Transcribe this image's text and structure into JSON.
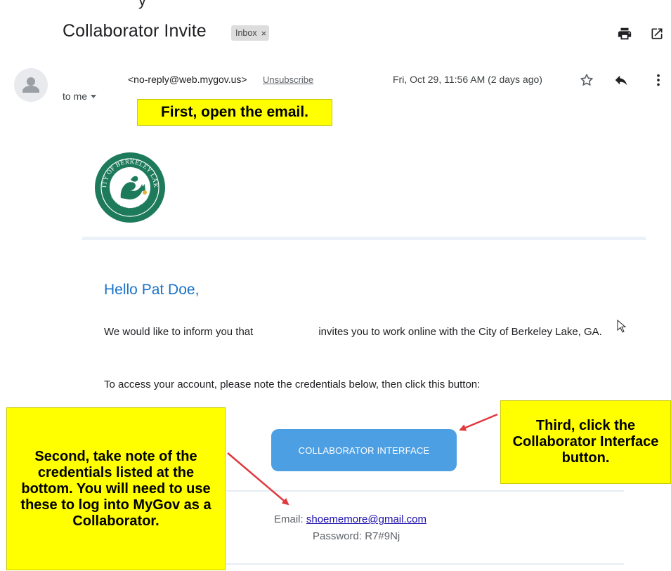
{
  "header": {
    "partial_text": "y",
    "subject": "Collaborator Invite",
    "label_badge": "Inbox",
    "label_close": "×",
    "print_icon": "print-icon",
    "new_window_icon": "open-in-new-icon"
  },
  "message": {
    "sender": "<no-reply@web.mygov.us>",
    "unsubscribe": "Unsubscribe",
    "date": "Fri, Oct 29, 11:56 AM (2 days ago)",
    "to": "to me",
    "icons": [
      "avatar-icon",
      "star-icon",
      "reply-icon",
      "more-vert-icon"
    ]
  },
  "annotations": {
    "first": "First, open the email.",
    "second": "Second, take note of the credentials listed at the bottom. You will need to use these to log into MyGov as a Collaborator.",
    "third": "Third, click the Collaborator Interface button."
  },
  "body": {
    "greeting": "Hello Pat Doe,",
    "intro_before": "We would like to inform you that",
    "intro_after": "invites you to work online with the City of Berkeley Lake, GA.",
    "instructions": "To access your account, please note the credentials below, then click this button:",
    "button_label": "COLLABORATOR INTERFACE",
    "email_label": "Email:",
    "email_value": "shoememore@gmail.com",
    "password_label": "Password:",
    "password_value": "R7#9Nj"
  },
  "logo": {
    "text_top": "CITY OF BERKELEY LAKE",
    "text_bottom": "ESTABLISHED 1956"
  },
  "colors": {
    "callout": "#ffff00",
    "button": "#4d9fe3",
    "greeting": "#1a73c9",
    "arrow": "#e0393e",
    "logo_green": "#1d7a5a"
  }
}
